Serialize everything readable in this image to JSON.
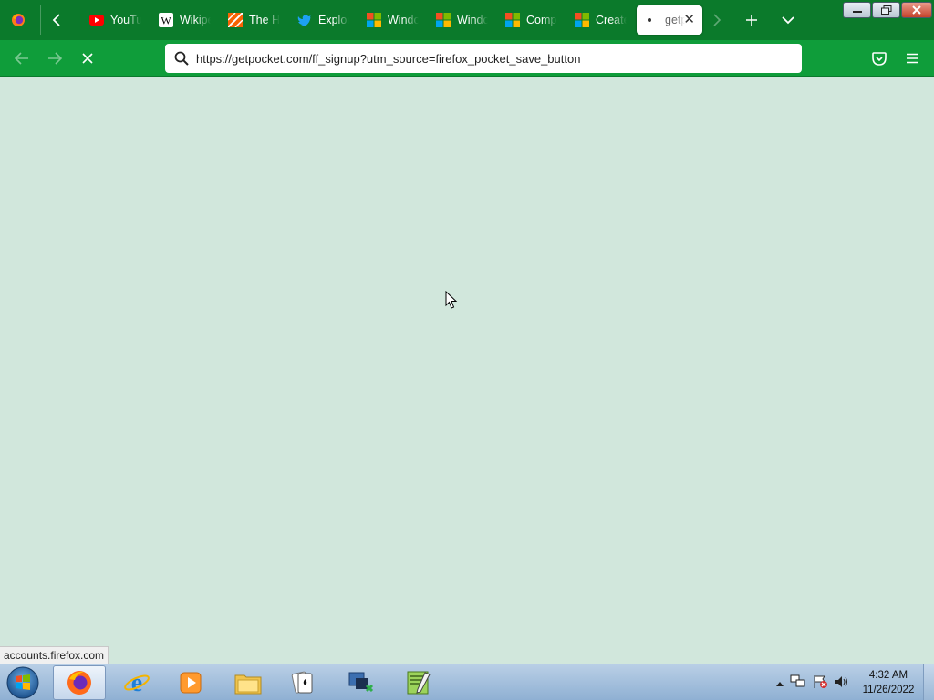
{
  "browser": {
    "tabs": [
      {
        "title": "YouTube",
        "icon": "youtube-icon"
      },
      {
        "title": "Wikipedia",
        "icon": "wikipedia-icon"
      },
      {
        "title": "The Home Depot",
        "icon": "home-depot-icon"
      },
      {
        "title": "Explore",
        "icon": "twitter-icon"
      },
      {
        "title": "Windows",
        "icon": "microsoft-icon"
      },
      {
        "title": "Windows",
        "icon": "microsoft-icon"
      },
      {
        "title": "Compare",
        "icon": "microsoft-icon"
      },
      {
        "title": "Create",
        "icon": "microsoft-icon"
      },
      {
        "title": "getpocket.com",
        "icon": "loading-dot-icon",
        "active": true
      }
    ],
    "url": "https://getpocket.com/ff_signup?utm_source=firefox_pocket_save_button",
    "status_text": "accounts.firefox.com"
  },
  "taskbar": {
    "apps": [
      "Firefox",
      "Internet Explorer",
      "Windows Media Player",
      "Windows Explorer",
      "Solitaire",
      "Network App",
      "Notepad++"
    ],
    "time": "4:32 AM",
    "date": "11/26/2022"
  },
  "colors": {
    "tab_strip": "#0b7a2b",
    "nav_bar": "#0f9d3a",
    "content_bg": "#d1e7dc",
    "taskbar": "#a6c0df"
  }
}
